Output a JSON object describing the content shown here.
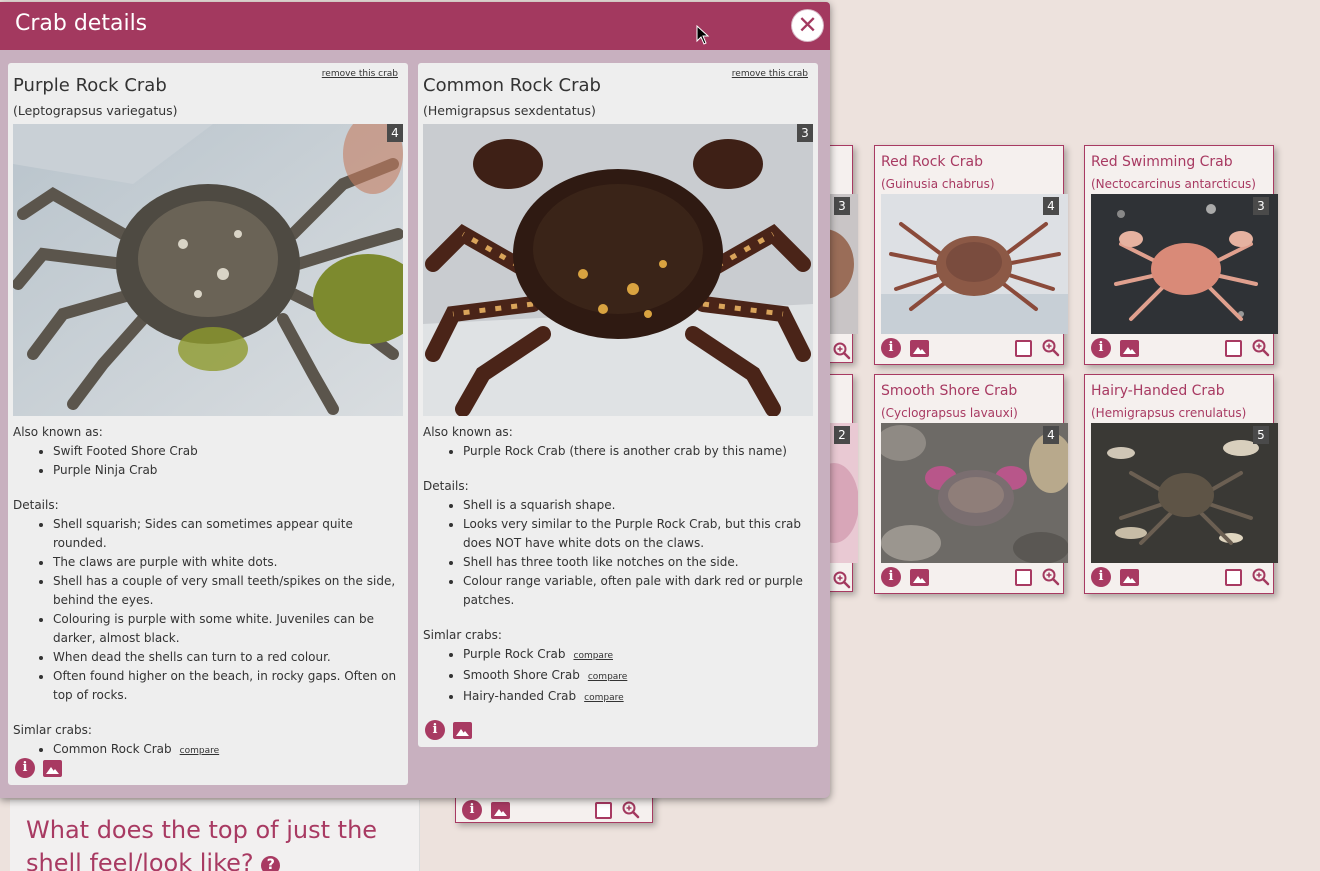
{
  "modal": {
    "title": "Crab details",
    "close_glyph": "✕",
    "crabs": [
      {
        "name": "Purple Rock Crab",
        "latin": "(Leptograpsus variegatus)",
        "remove_label": "remove this crab",
        "photo_count": "4",
        "aka_heading": "Also known as:",
        "aka": [
          "Swift Footed Shore Crab",
          "Purple Ninja Crab"
        ],
        "details_heading": "Details:",
        "details": [
          "Shell squarish; Sides can sometimes appear quite rounded.",
          "The claws are purple with white dots.",
          "Shell has a couple of very small teeth/spikes on the side, behind the eyes.",
          "Colouring is purple with some white. Juveniles can be darker, almost black.",
          "When dead the shells can turn to a red colour.",
          "Often found higher on the beach, in rocky gaps. Often on top of rocks."
        ],
        "similar_heading": "Simlar crabs:",
        "similar": [
          {
            "name": "Common Rock Crab",
            "compare": "compare"
          }
        ]
      },
      {
        "name": "Common Rock Crab",
        "latin": "(Hemigrapsus sexdentatus)",
        "remove_label": "remove this crab",
        "photo_count": "3",
        "aka_heading": "Also known as:",
        "aka": [
          "Purple Rock Crab (there is another crab by this name)"
        ],
        "details_heading": "Details:",
        "details": [
          "Shell is a squarish shape.",
          "Looks very similar to the Purple Rock Crab, but this crab does NOT have white dots on the claws.",
          "Shell has three tooth like notches on the side.",
          "Colour range variable, often pale with dark red or purple patches."
        ],
        "similar_heading": "Simlar crabs:",
        "similar": [
          {
            "name": "Purple Rock Crab",
            "compare": "compare"
          },
          {
            "name": "Smooth Shore Crab",
            "compare": "compare"
          },
          {
            "name": "Hairy-handed Crab",
            "compare": "compare"
          }
        ]
      }
    ]
  },
  "background_cards": [
    {
      "name": "Red Rock Crab",
      "latin": "(Guinusia chabrus)",
      "count": "4"
    },
    {
      "name": "Red Swimming Crab",
      "latin": "(Nectocarcinus antarcticus)",
      "count": "3"
    },
    {
      "name": "Smooth Shore Crab",
      "latin": "(Cyclograpsus lavauxi)",
      "count": "4"
    },
    {
      "name": "Hairy-Handed Crab",
      "latin": "(Hemigrapsus crenulatus)",
      "count": "5"
    }
  ],
  "partial_card_counts": [
    "3",
    "2"
  ],
  "question": {
    "text": "What does the top of just the shell feel/look like?",
    "help_glyph": "?"
  },
  "icons": {
    "info": "i",
    "accent": "#a3395f"
  }
}
